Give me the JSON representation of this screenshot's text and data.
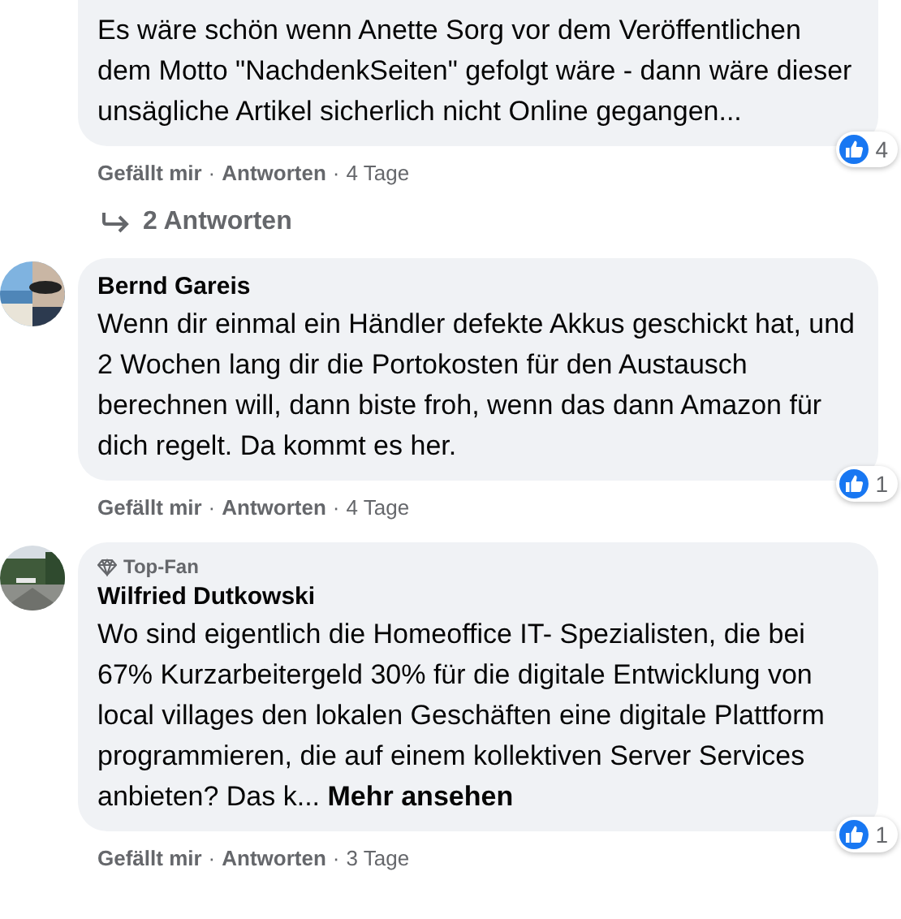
{
  "comments": [
    {
      "text": "Es wäre schön wenn Anette Sorg vor dem Veröffentlichen dem Motto \"NachdenkSeiten\" gefolgt wäre - dann wäre dieser unsägliche Artikel sicherlich nicht Online gegangen...",
      "reactions": "4",
      "like": "Gefällt mir",
      "separator": "·",
      "reply": "Antworten",
      "time": "4 Tage",
      "replies": "2 Antworten"
    },
    {
      "author": "Bernd Gareis",
      "text": "Wenn dir einmal ein Händler defekte Akkus geschickt hat, und 2 Wochen lang dir die Portokosten für den Austausch berechnen will, dann biste froh, wenn das dann Amazon für dich regelt. Da kommt es her.",
      "reactions": "1",
      "like": "Gefällt mir",
      "separator": "·",
      "reply": "Antworten",
      "time": "4 Tage"
    },
    {
      "badge": "Top-Fan",
      "author": "Wilfried Dutkowski",
      "text": "Wo sind eigentlich die Homeoffice IT- Spezialisten, die bei 67% Kurzarbeitergeld 30% für die digitale Entwicklung von local villages den lokalen Geschäften eine digitale Plattform programmieren, die auf einem kollektiven Server Services anbieten? Das k...",
      "more": "Mehr ansehen",
      "reactions": "1",
      "like": "Gefällt mir",
      "separator": "·",
      "reply": "Antworten",
      "time": "3 Tage"
    }
  ]
}
